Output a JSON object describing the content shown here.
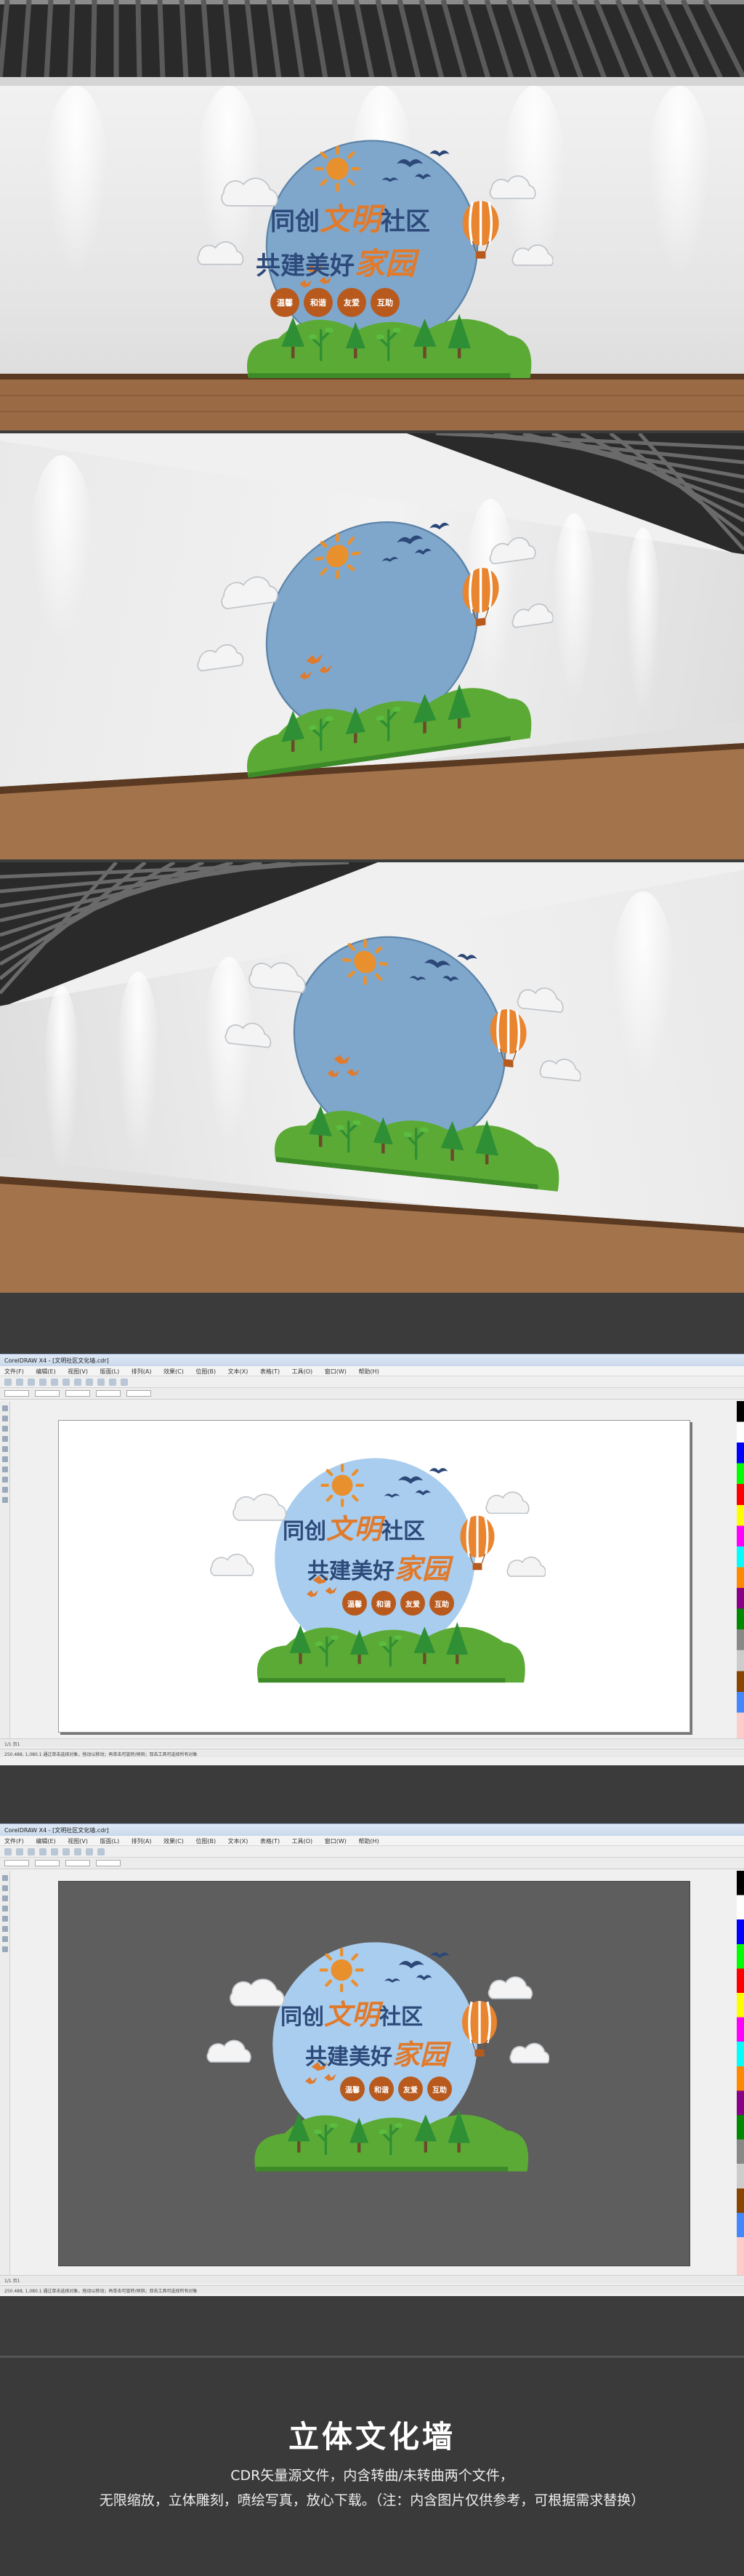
{
  "sign": {
    "line1_a": "同创",
    "line1_b": "文明",
    "line1_c": "社区",
    "line2_a": "共建美好",
    "line2_b": "家园",
    "badges": [
      "温馨",
      "和谐",
      "友爱",
      "互助"
    ]
  },
  "software": {
    "title": "CorelDRAW X4 - [文明社区文化墙.cdr]",
    "menu": [
      "文件(F)",
      "编辑(E)",
      "视图(V)",
      "版面(L)",
      "排列(A)",
      "效果(C)",
      "位图(B)",
      "文本(X)",
      "表格(T)",
      "工具(O)",
      "窗口(W)",
      "帮助(H)"
    ],
    "status_1": "1/1  页1",
    "status_2": "250.488, 1,080.1   通过单击选择对象，拖动以移动；再单击可旋转/倾斜；双击工具可选择所有对象"
  },
  "footer": {
    "title": "立体文化墙",
    "line1": "CDR矢量源文件，内含转曲/未转曲两个文件，",
    "line2": "无限缩放，立体雕刻，喷绘写真，放心下载。（注：内含图片仅供参考，可根据需求替换）"
  },
  "colors": {
    "circle": "#7fa7cc",
    "circle_flat": "#a9cdee",
    "navy": "#2d4a7a",
    "orange": "#e07a2c",
    "badge": "#b85a1e",
    "green": "#5ba83a",
    "tree": "#3e9a3a"
  }
}
